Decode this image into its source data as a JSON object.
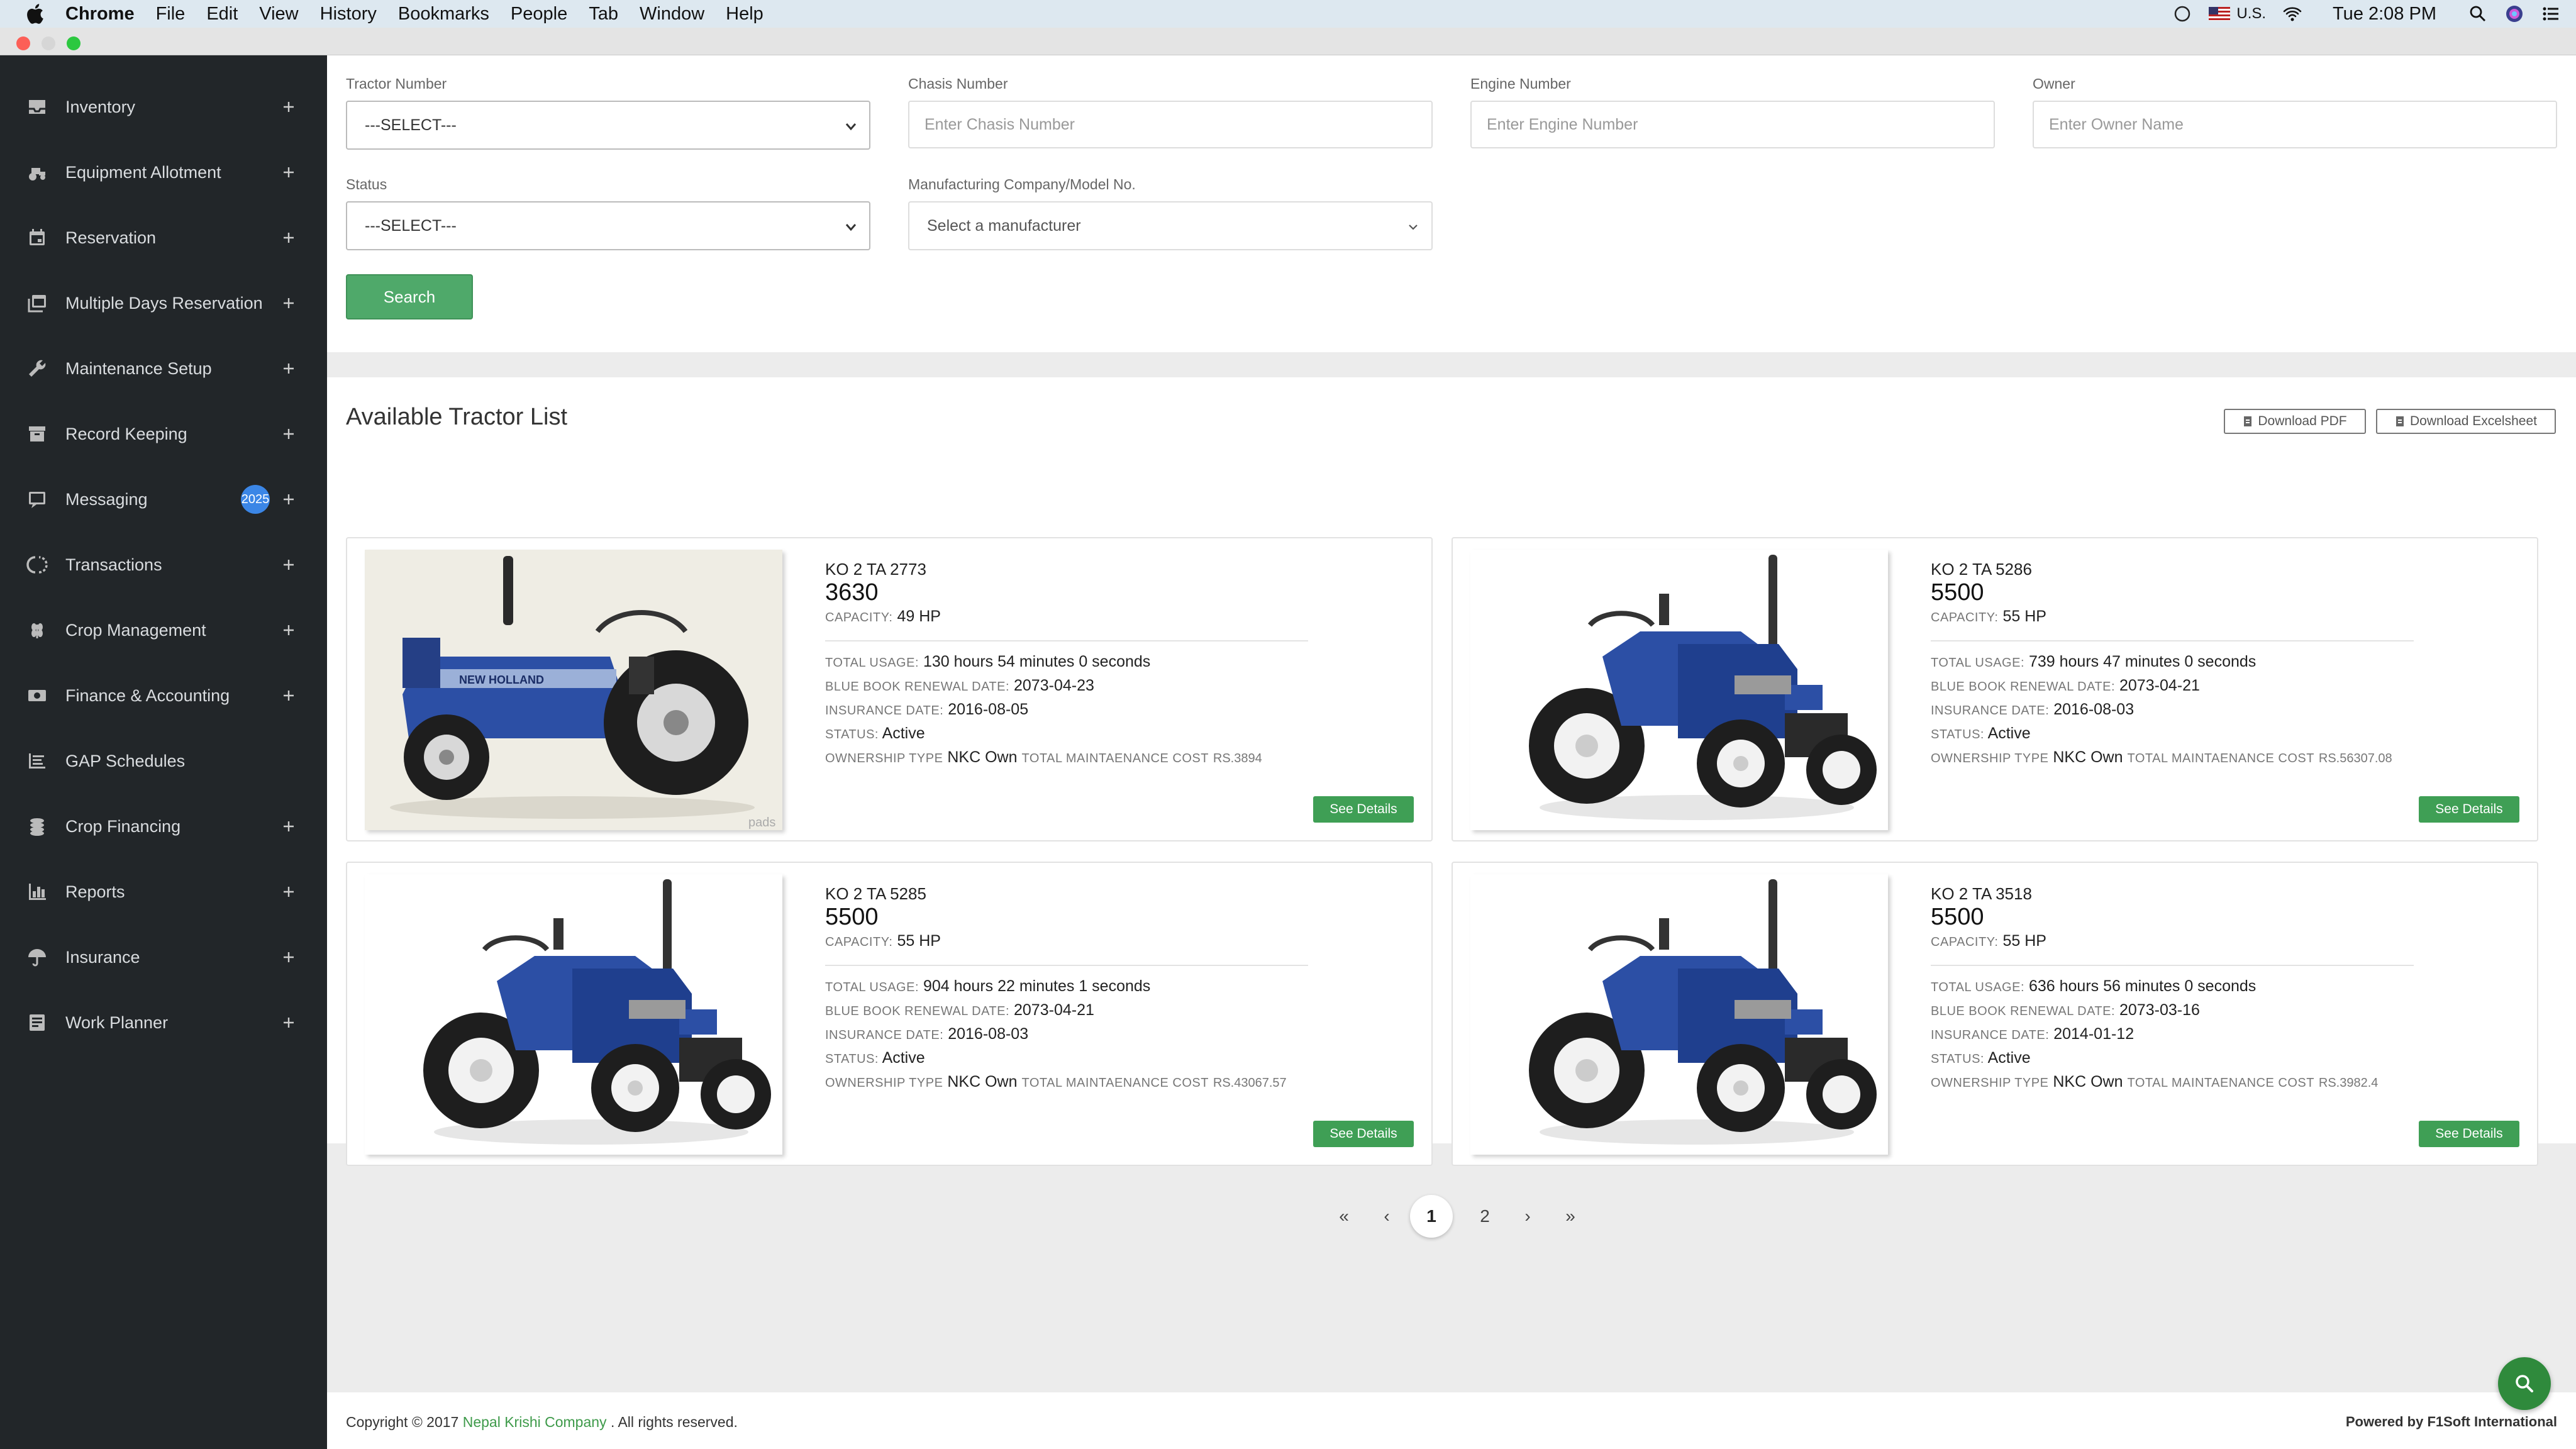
{
  "menubar": {
    "items": [
      "Chrome",
      "File",
      "Edit",
      "View",
      "History",
      "Bookmarks",
      "People",
      "Tab",
      "Window",
      "Help"
    ],
    "locale": "U.S.",
    "clock": "Tue 2:08 PM"
  },
  "sidebar": {
    "items": [
      {
        "label": "Inventory",
        "icon": "inbox-icon",
        "expandable": true
      },
      {
        "label": "Equipment Allotment",
        "icon": "tractor-icon",
        "expandable": true
      },
      {
        "label": "Reservation",
        "icon": "calendar-icon",
        "expandable": true
      },
      {
        "label": "Multiple Days Reservation",
        "icon": "calendar-multiple-icon",
        "expandable": true
      },
      {
        "label": "Maintenance Setup",
        "icon": "wrench-icon",
        "expandable": true
      },
      {
        "label": "Record Keeping",
        "icon": "archive-icon",
        "expandable": true
      },
      {
        "label": "Messaging",
        "icon": "message-icon",
        "expandable": true,
        "badge": "2025"
      },
      {
        "label": "Transactions",
        "icon": "exchange-icon",
        "expandable": true
      },
      {
        "label": "Crop Management",
        "icon": "crop-icon",
        "expandable": true
      },
      {
        "label": "Finance & Accounting",
        "icon": "money-icon",
        "expandable": true
      },
      {
        "label": "GAP Schedules",
        "icon": "schedule-icon",
        "expandable": false
      },
      {
        "label": "Crop Financing",
        "icon": "coins-icon",
        "expandable": true
      },
      {
        "label": "Reports",
        "icon": "bar-chart-icon",
        "expandable": true
      },
      {
        "label": "Insurance",
        "icon": "umbrella-icon",
        "expandable": true
      },
      {
        "label": "Work Planner",
        "icon": "planner-icon",
        "expandable": true
      }
    ]
  },
  "filters": {
    "tractor_number": {
      "label": "Tractor Number",
      "value": "---SELECT---"
    },
    "chasis_number": {
      "label": "Chasis Number",
      "placeholder": "Enter Chasis Number"
    },
    "engine_number": {
      "label": "Engine Number",
      "placeholder": "Enter Engine Number"
    },
    "owner": {
      "label": "Owner",
      "placeholder": "Enter Owner Name"
    },
    "status": {
      "label": "Status",
      "value": "---SELECT---"
    },
    "manufacturer": {
      "label": "Manufacturing Company/Model No.",
      "value": "Select a manufacturer"
    },
    "search_label": "Search"
  },
  "list": {
    "title": "Available Tractor List",
    "download_pdf": "Download PDF",
    "download_excel": "Download Excelsheet",
    "labels": {
      "capacity": "CAPACITY:",
      "total_usage": "TOTAL USAGE:",
      "bluebook": "BLUE BOOK RENEWAL DATE:",
      "insurance": "INSURANCE DATE:",
      "status": "STATUS:",
      "ownership": "OWNERSHIP TYPE",
      "maint": "TOTAL MAINTAENANCE COST",
      "see_details": "See Details"
    },
    "tractors": [
      {
        "reg": "KO 2 TA 2773",
        "model": "3630",
        "capacity": "49 HP",
        "usage": "130 hours 54 minutes 0 seconds",
        "bluebook": "2073-04-23",
        "insurance": "2016-08-05",
        "status": "Active",
        "ownership": "NKC Own",
        "maint": "RS.3894",
        "photo": "tractor-3630-side",
        "watermark": "pads"
      },
      {
        "reg": "KO 2 TA 5286",
        "model": "5500",
        "capacity": "55 HP",
        "usage": "739 hours 47 minutes 0 seconds",
        "bluebook": "2073-04-21",
        "insurance": "2016-08-03",
        "status": "Active",
        "ownership": "NKC Own",
        "maint": "RS.56307.08",
        "photo": "tractor-5500-front"
      },
      {
        "reg": "KO 2 TA 5285",
        "model": "5500",
        "capacity": "55 HP",
        "usage": "904 hours 22 minutes 1 seconds",
        "bluebook": "2073-04-21",
        "insurance": "2016-08-03",
        "status": "Active",
        "ownership": "NKC Own",
        "maint": "RS.43067.57",
        "photo": "tractor-5500-front"
      },
      {
        "reg": "KO 2 TA 3518",
        "model": "5500",
        "capacity": "55 HP",
        "usage": "636 hours 56 minutes 0 seconds",
        "bluebook": "2073-03-16",
        "insurance": "2014-01-12",
        "status": "Active",
        "ownership": "NKC Own",
        "maint": "RS.3982.4",
        "photo": "tractor-5500-front"
      }
    ]
  },
  "pagination": {
    "first": "«",
    "prev": "‹",
    "pages": [
      "1",
      "2"
    ],
    "current": "1",
    "next": "›",
    "last": "»"
  },
  "footer": {
    "copyright_prefix": "Copyright © 2017",
    "company": "Nepal Krishi Company",
    "copyright_suffix": ". All rights reserved.",
    "powered": "Powered by F1Soft International"
  },
  "colors": {
    "sidebar": "#222629",
    "accent_green": "#4fa96a",
    "badge_blue": "#3b86e6",
    "tractor_blue": "#2c4fa5"
  }
}
